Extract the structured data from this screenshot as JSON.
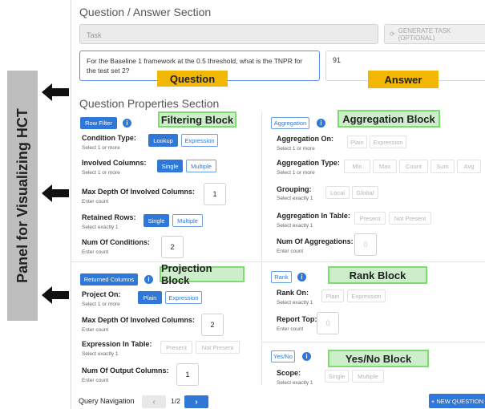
{
  "side_panel": {
    "label": "Panel for Visualizing HCT"
  },
  "qa": {
    "title": "Question / Answer Section",
    "task_placeholder": "Task",
    "generate_label": "GENERATE TASK (OPTIONAL)",
    "question_text": "For the Baseline 1 framework at the 0.5 threshold, what is the TNPR for the test set 2?",
    "answer_text": "91",
    "question_callout": "Question",
    "answer_callout": "Answer"
  },
  "props": {
    "title": "Question Properties Section",
    "filter": {
      "button": "Row Filter",
      "callout": "Filtering Block",
      "condition_type": {
        "label": "Condition Type:",
        "sub": "Select 1 or more",
        "options": [
          "Lookup",
          "Expression"
        ]
      },
      "involved_columns": {
        "label": "Involved Columns:",
        "sub": "Select 1 or more",
        "options": [
          "Single",
          "Multiple"
        ]
      },
      "max_depth": {
        "label": "Max Depth Of Involved Columns:",
        "sub": "Enter count",
        "value": "1"
      },
      "retained_rows": {
        "label": "Retained Rows:",
        "sub": "Select exactly 1",
        "options": [
          "Single",
          "Multiple"
        ]
      },
      "num_conditions": {
        "label": "Num Of Conditions:",
        "sub": "Enter count",
        "value": "2"
      }
    },
    "aggregation": {
      "button": "Aggregation",
      "callout": "Aggregation Block",
      "on": {
        "label": "Aggregation On:",
        "sub": "Select 1 or more",
        "options": [
          "Plain",
          "Expression"
        ]
      },
      "type": {
        "label": "Aggregation Type:",
        "sub": "Select 1 or more",
        "options": [
          "Min",
          "Max",
          "Count",
          "Sum",
          "Avg"
        ]
      },
      "grouping": {
        "label": "Grouping:",
        "sub": "Select exactly 1",
        "options": [
          "Local",
          "Global"
        ]
      },
      "in_table": {
        "label": "Aggregation In Table:",
        "sub": "Select exactly 1",
        "options": [
          "Present",
          "Not Present"
        ]
      },
      "num": {
        "label": "Num Of Aggregations:",
        "sub": "Enter count",
        "value": "0"
      }
    },
    "projection": {
      "button": "Returned Columns",
      "callout": "Projection Block",
      "project_on": {
        "label": "Project On:",
        "sub": "Select 1 or more",
        "options": [
          "Plain",
          "Expression"
        ]
      },
      "max_depth": {
        "label": "Max Depth Of Involved Columns:",
        "sub": "Enter count",
        "value": "2"
      },
      "expr_in_table": {
        "label": "Expression In Table:",
        "sub": "Select exactly 1",
        "options": [
          "Present",
          "Not Present"
        ]
      },
      "num_output": {
        "label": "Num Of Output Columns:",
        "sub": "Enter count",
        "value": "1"
      }
    },
    "rank": {
      "button": "Rank",
      "callout": "Rank Block",
      "on": {
        "label": "Rank On:",
        "sub": "Select exactly 1",
        "options": [
          "Plain",
          "Expression"
        ]
      },
      "report_top": {
        "label": "Report Top:",
        "sub": "Enter count",
        "value": "0"
      }
    },
    "yesno": {
      "button": "Yes/No",
      "callout": "Yes/No Block",
      "scope": {
        "label": "Scope:",
        "sub": "Select exactly 1",
        "options": [
          "Single",
          "Multiple"
        ]
      }
    }
  },
  "nav": {
    "label": "Query Navigation",
    "page": "1/2",
    "prev_icon": "chevron-left-icon",
    "next_icon": "chevron-right-icon",
    "new_question": "+ NEW QUESTION"
  },
  "colors": {
    "accent": "#2f78d8",
    "callout_orange": "#f2b705",
    "callout_green": "#cdeecb",
    "callout_green_border": "#7ddc6e",
    "side_panel": "#bdbdbd"
  }
}
